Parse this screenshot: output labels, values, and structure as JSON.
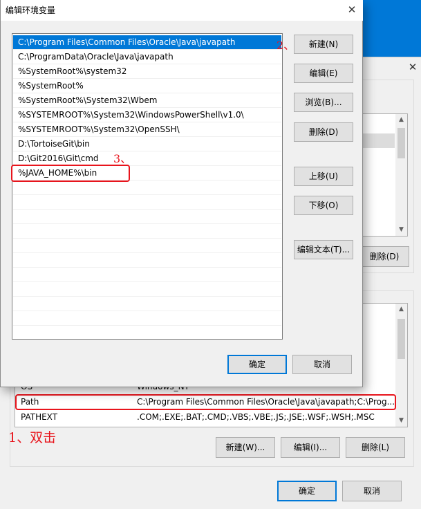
{
  "background_window": {
    "close_glyph": "✕",
    "user_var_buttons": {
      "delete": "删除(D)"
    },
    "system_vars": [
      {
        "name": "OS",
        "value": "Windows_NT"
      },
      {
        "name": "Path",
        "value": "C:\\Program Files\\Common Files\\Oracle\\Java\\javapath;C:\\Prog..."
      },
      {
        "name": "PATHEXT",
        "value": ".COM;.EXE;.BAT;.CMD;.VBS;.VBE;.JS;.JSE;.WSF;.WSH;.MSC"
      }
    ],
    "system_var_buttons": {
      "new": "新建(W)...",
      "edit": "编辑(I)...",
      "delete": "删除(L)"
    },
    "ok": "确定",
    "cancel": "取消"
  },
  "dialog": {
    "title": "编辑环境变量",
    "close_glyph": "✕",
    "paths": [
      "C:\\Program Files\\Common Files\\Oracle\\Java\\javapath",
      "C:\\ProgramData\\Oracle\\Java\\javapath",
      "%SystemRoot%\\system32",
      "%SystemRoot%",
      "%SystemRoot%\\System32\\Wbem",
      "%SYSTEMROOT%\\System32\\WindowsPowerShell\\v1.0\\",
      "%SYSTEMROOT%\\System32\\OpenSSH\\",
      "D:\\TortoiseGit\\bin",
      "D:\\Git2016\\Git\\cmd",
      "%JAVA_HOME%\\bin"
    ],
    "buttons": {
      "new": "新建(N)",
      "edit": "编辑(E)",
      "browse": "浏览(B)...",
      "delete": "删除(D)",
      "move_up": "上移(U)",
      "move_down": "下移(O)",
      "edit_text": "编辑文本(T)...",
      "ok": "确定",
      "cancel": "取消"
    }
  },
  "annotations": {
    "step1": "1、双击",
    "step2": "2、",
    "step3": "3、"
  },
  "colors": {
    "accent": "#0078d7",
    "annotation": "#e8141c"
  }
}
